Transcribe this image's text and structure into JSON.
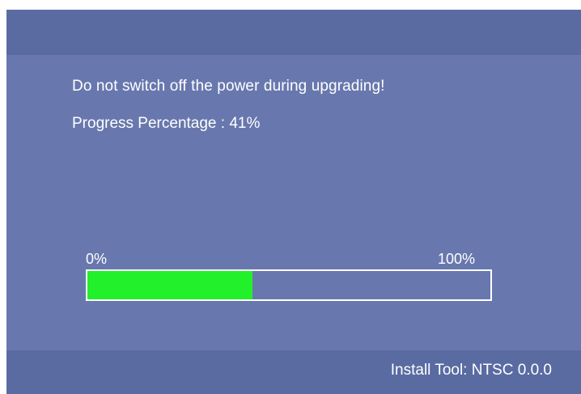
{
  "dialog": {
    "warning": "Do not switch off the power during upgrading!",
    "progress_label": "Progress Percentage : 41%",
    "progress_value": 41,
    "scale_min": "0%",
    "scale_max": "100%"
  },
  "footer": {
    "install_tool": "Install Tool: NTSC 0.0.0"
  },
  "colors": {
    "background": "#6878ae",
    "bars": "#5a6ba2",
    "progress_fill": "#22f02a",
    "text": "#ffffff"
  }
}
